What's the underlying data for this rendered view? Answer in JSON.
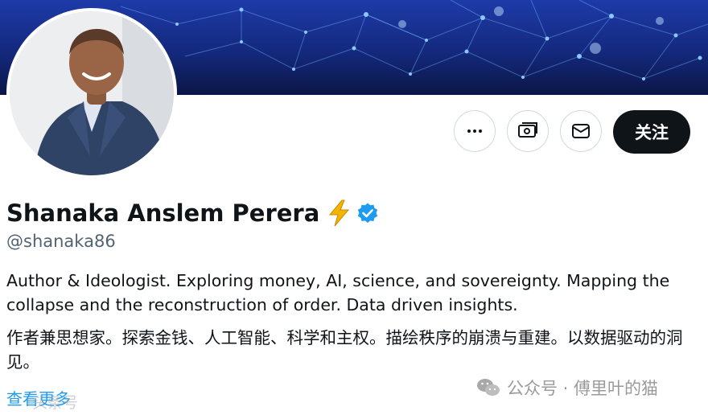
{
  "profile": {
    "display_name": "Shanaka Anslem Perera",
    "name_emoji": "lightning-emoji",
    "verified_icon": "verified-badge-icon",
    "handle": "@shanaka86",
    "bio_en": "Author & Ideologist. Exploring money, AI, science, and sovereignty. Mapping the collapse and the reconstruction of order. Data driven insights.",
    "bio_zh": "作者兼思想家。探索金钱、人工智能、科学和主权。描绘秩序的崩溃与重建。以数据驱动的洞见。",
    "show_more": "查看更多"
  },
  "actions": {
    "more_icon": "more-dots-icon",
    "subscribe_icon": "subscribe-money-icon",
    "message_icon": "envelope-icon",
    "follow_label": "关注"
  },
  "watermark": {
    "bottom_text": "头条号",
    "right_text": "公众号 · 傅里叶的猫",
    "right_icon": "wechat-icon"
  },
  "colors": {
    "accent": "#1d9bf0",
    "follow_bg": "#0f1419",
    "verified": "#1d9bf0",
    "banner": "#1b3aa6"
  }
}
